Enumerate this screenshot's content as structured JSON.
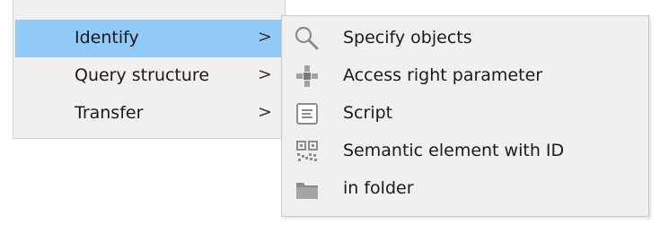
{
  "main_menu": {
    "items": [
      {
        "label": "Identify",
        "arrow": ">",
        "highlighted": true
      },
      {
        "label": "Query structure",
        "arrow": ">",
        "highlighted": false
      },
      {
        "label": "Transfer",
        "arrow": ">",
        "highlighted": false
      }
    ]
  },
  "submenu": {
    "items": [
      {
        "label": "Specify objects",
        "icon": "search-icon"
      },
      {
        "label": "Access right parameter",
        "icon": "access-right-icon"
      },
      {
        "label": "Script",
        "icon": "script-icon"
      },
      {
        "label": "Semantic element with ID",
        "icon": "qr-code-icon"
      },
      {
        "label": "in folder",
        "icon": "folder-icon"
      }
    ]
  },
  "colors": {
    "menu_bg": "#f0f0f0",
    "highlight": "#91c9f7",
    "text": "#1a1a1a",
    "icon_gray": "#9a9a9a"
  }
}
